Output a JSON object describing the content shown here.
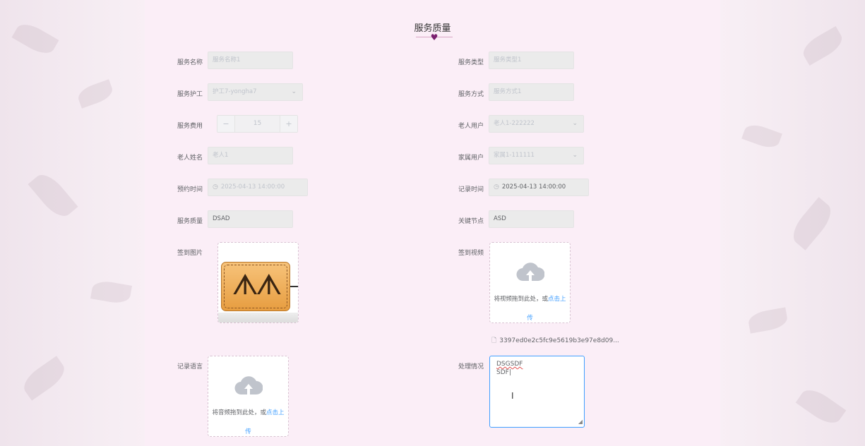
{
  "page": {
    "title": "服务质量"
  },
  "form": {
    "service_name": {
      "label": "服务名称",
      "placeholder": "服务名称1"
    },
    "service_type": {
      "label": "服务类型",
      "placeholder": "服务类型1"
    },
    "caregiver": {
      "label": "服务护工",
      "value": "护工7-yongha7"
    },
    "service_method": {
      "label": "服务方式",
      "placeholder": "服务方式1"
    },
    "service_fee": {
      "label": "服务费用",
      "value": "15",
      "minus": "−",
      "plus": "+"
    },
    "elder_user": {
      "label": "老人用户",
      "value": "老人1-222222"
    },
    "elder_name": {
      "label": "老人姓名",
      "placeholder": "老人1"
    },
    "family_user": {
      "label": "家属用户",
      "value": "家属1-111111"
    },
    "appointment_time": {
      "label": "预约时间",
      "value": "2025-04-13 14:00:00"
    },
    "record_time": {
      "label": "记录时间",
      "value": "2025-04-13 14:00:00"
    },
    "service_quality": {
      "label": "服务质量",
      "value": "DSAD"
    },
    "key_node": {
      "label": "关键节点",
      "value": "ASD"
    },
    "checkin_image": {
      "label": "签到图片"
    },
    "checkin_video": {
      "label": "签到视频",
      "prompt": "将视频拖到此处，或",
      "link": "点击上",
      "link2": "传",
      "file_name": "3397ed0e2c5fc9e5619b3e97e8d09..."
    },
    "record_voice": {
      "label": "记录语言",
      "prompt": "将音频拖到此处，或",
      "link": "点击上",
      "link2": "传"
    },
    "handling": {
      "label": "处理情况",
      "line1": "DSGSDF",
      "line2": "SDF|"
    }
  },
  "icons": {
    "chevron": "chevron-down-icon",
    "clock": "clock-icon",
    "cloud": "cloud-upload-icon",
    "document": "document-icon",
    "heart": "heart-icon"
  },
  "colors": {
    "accent": "#409eff",
    "heart": "#7a1f6f",
    "background": "#fbeef7"
  }
}
